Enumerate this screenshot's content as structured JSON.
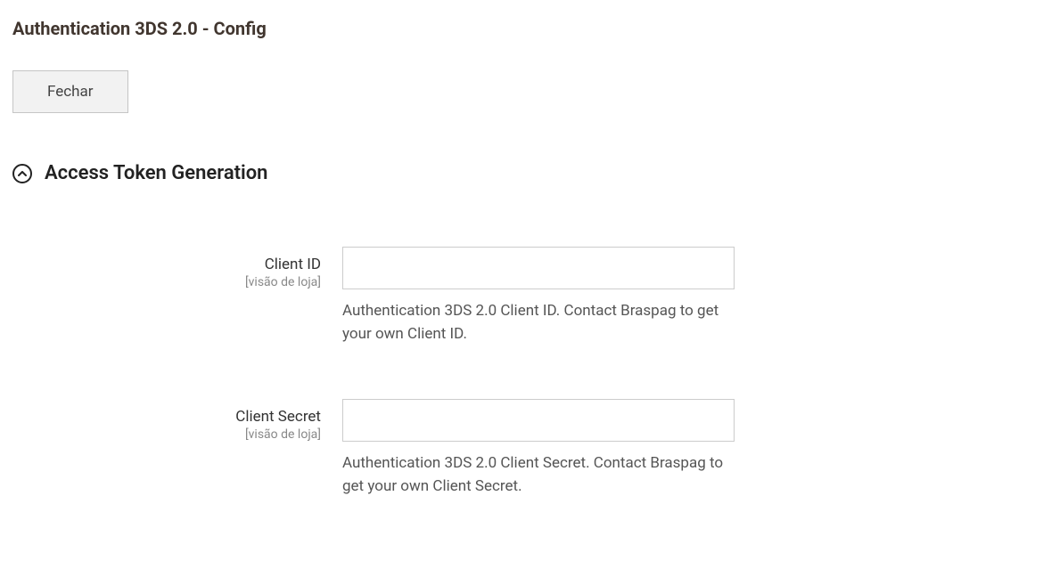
{
  "header": {
    "title": "Authentication 3DS 2.0 - Config",
    "close_label": "Fechar"
  },
  "section": {
    "title": "Access Token Generation"
  },
  "fields": {
    "client_id": {
      "label": "Client ID",
      "scope": "[visão de loja]",
      "value": "",
      "help": "Authentication 3DS 2.0 Client ID. Contact Braspag to get your own Client ID."
    },
    "client_secret": {
      "label": "Client Secret",
      "scope": "[visão de loja]",
      "value": "",
      "help": "Authentication 3DS 2.0 Client Secret. Contact Braspag to get your own Client Secret."
    }
  }
}
